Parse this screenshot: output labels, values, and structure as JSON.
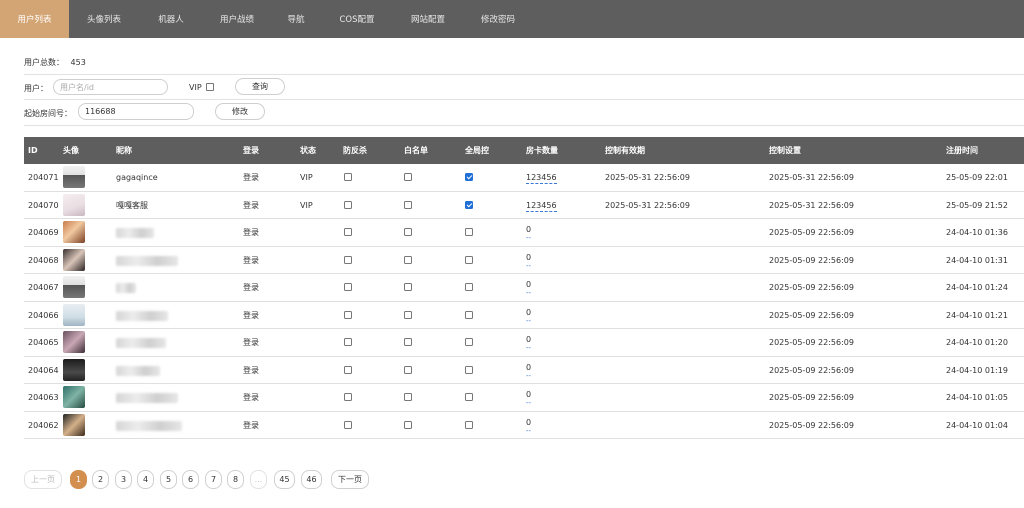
{
  "nav": {
    "items": [
      "用户列表",
      "头像列表",
      "机器人",
      "用户战绩",
      "导航",
      "COS配置",
      "网站配置",
      "修改密码"
    ],
    "active_index": 0,
    "active_color": "#d4a574",
    "bg_color": "#5e5e5e"
  },
  "summary": {
    "label": "用户总数：",
    "value": "453"
  },
  "search": {
    "user_label": "用户：",
    "user_placeholder": "用户名/id",
    "user_value": "",
    "vip_label": "VIP",
    "vip_checked": false,
    "query_button": "查询"
  },
  "room": {
    "label": "起始房间号：",
    "value": "116688",
    "modify_button": "修改"
  },
  "table": {
    "headers": {
      "id": "ID",
      "avatar": "头像",
      "nickname": "昵称",
      "login": "登录",
      "status": "状态",
      "anti_kill": "防反杀",
      "whitelist": "白名单",
      "full_control": "全局控",
      "room_cards": "房卡数量",
      "control_valid": "控制有效期",
      "control_setting": "控制设置",
      "reg_time": "注册时间"
    },
    "rows": [
      {
        "id": "204071",
        "nickname": "gagaqince",
        "login": "登录",
        "status": "VIP",
        "anti_kill": false,
        "whitelist": false,
        "full_control": true,
        "room_cards": "123456",
        "control_valid": "2025-05-31 22:56:09",
        "control_setting": "2025-05-31 22:56:09",
        "reg_time": "25-05-09 22:01"
      },
      {
        "id": "204070",
        "nickname": "嘎嘎客服",
        "login": "登录",
        "status": "VIP",
        "anti_kill": false,
        "whitelist": false,
        "full_control": true,
        "room_cards": "123456",
        "control_valid": "2025-05-31 22:56:09",
        "control_setting": "2025-05-31 22:56:09",
        "reg_time": "25-05-09 21:52"
      },
      {
        "id": "204069",
        "nickname": "",
        "login": "登录",
        "status": "",
        "anti_kill": false,
        "whitelist": false,
        "full_control": false,
        "room_cards": "0",
        "control_valid": "",
        "control_setting": "2025-05-09 22:56:09",
        "reg_time": "24-04-10 01:36"
      },
      {
        "id": "204068",
        "nickname": "",
        "login": "登录",
        "status": "",
        "anti_kill": false,
        "whitelist": false,
        "full_control": false,
        "room_cards": "0",
        "control_valid": "",
        "control_setting": "2025-05-09 22:56:09",
        "reg_time": "24-04-10 01:31"
      },
      {
        "id": "204067",
        "nickname": "",
        "login": "登录",
        "status": "",
        "anti_kill": false,
        "whitelist": false,
        "full_control": false,
        "room_cards": "0",
        "control_valid": "",
        "control_setting": "2025-05-09 22:56:09",
        "reg_time": "24-04-10 01:24"
      },
      {
        "id": "204066",
        "nickname": "",
        "login": "登录",
        "status": "",
        "anti_kill": false,
        "whitelist": false,
        "full_control": false,
        "room_cards": "0",
        "control_valid": "",
        "control_setting": "2025-05-09 22:56:09",
        "reg_time": "24-04-10 01:21"
      },
      {
        "id": "204065",
        "nickname": "",
        "login": "登录",
        "status": "",
        "anti_kill": false,
        "whitelist": false,
        "full_control": false,
        "room_cards": "0",
        "control_valid": "",
        "control_setting": "2025-05-09 22:56:09",
        "reg_time": "24-04-10 01:20"
      },
      {
        "id": "204064",
        "nickname": "",
        "login": "登录",
        "status": "",
        "anti_kill": false,
        "whitelist": false,
        "full_control": false,
        "room_cards": "0",
        "control_valid": "",
        "control_setting": "2025-05-09 22:56:09",
        "reg_time": "24-04-10 01:19"
      },
      {
        "id": "204063",
        "nickname": "",
        "login": "登录",
        "status": "",
        "anti_kill": false,
        "whitelist": false,
        "full_control": false,
        "room_cards": "0",
        "control_valid": "",
        "control_setting": "2025-05-09 22:56:09",
        "reg_time": "24-04-10 01:05"
      },
      {
        "id": "204062",
        "nickname": "",
        "login": "登录",
        "status": "",
        "anti_kill": false,
        "whitelist": false,
        "full_control": false,
        "room_cards": "0",
        "control_valid": "",
        "control_setting": "2025-05-09 22:56:09",
        "reg_time": "24-04-10 01:04"
      }
    ],
    "empty_card_link": "--",
    "checked_color": "#1f6fd6"
  },
  "pagination": {
    "prev": "上一页",
    "pages": [
      "1",
      "2",
      "3",
      "4",
      "5",
      "6",
      "7",
      "8",
      "...",
      "45",
      "46"
    ],
    "active": "1",
    "next": "下一页",
    "active_color": "#d38f4f"
  }
}
